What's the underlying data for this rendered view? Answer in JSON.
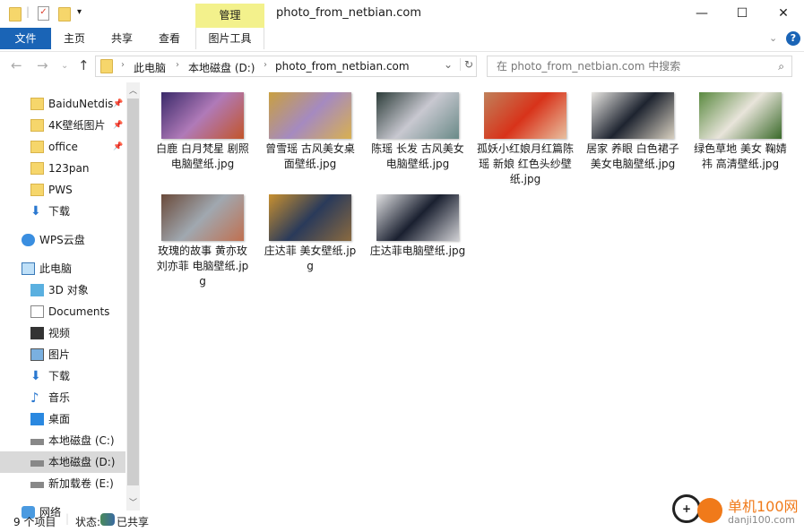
{
  "window": {
    "title": "photo_from_netbian.com",
    "minimize": "—",
    "maximize": "☐",
    "close": "✕"
  },
  "ribbon": {
    "context_group": "管理",
    "tabs": [
      "文件",
      "主页",
      "共享",
      "查看",
      "图片工具"
    ]
  },
  "address": {
    "path": [
      "此电脑",
      "本地磁盘 (D:)",
      "photo_from_netbian.com"
    ],
    "search_placeholder": "在 photo_from_netbian.com 中搜索"
  },
  "sidebar": {
    "items": [
      {
        "label": "BaiduNetdis",
        "icon": "folder-icon",
        "pinned": true
      },
      {
        "label": "4K壁纸图片",
        "icon": "folder-icon",
        "pinned": true
      },
      {
        "label": "office",
        "icon": "folder-icon",
        "pinned": true
      },
      {
        "label": "123pan",
        "icon": "folder-icon"
      },
      {
        "label": "PWS",
        "icon": "folder-icon"
      },
      {
        "label": "下载",
        "icon": "download-icon"
      },
      {
        "label": "WPS云盘",
        "icon": "cloud-icon"
      },
      {
        "label": "此电脑",
        "icon": "computer-icon"
      },
      {
        "label": "3D 对象",
        "icon": "3d-icon"
      },
      {
        "label": "Documents",
        "icon": "document-icon"
      },
      {
        "label": "视频",
        "icon": "video-icon"
      },
      {
        "label": "图片",
        "icon": "picture-icon"
      },
      {
        "label": "下载",
        "icon": "download-icon"
      },
      {
        "label": "音乐",
        "icon": "music-icon"
      },
      {
        "label": "桌面",
        "icon": "desktop-icon"
      },
      {
        "label": "本地磁盘 (C:)",
        "icon": "drive-icon"
      },
      {
        "label": "本地磁盘 (D:)",
        "icon": "drive-icon",
        "selected": true
      },
      {
        "label": "新加载卷 (E:)",
        "icon": "drive-icon"
      },
      {
        "label": "网络",
        "icon": "network-icon"
      }
    ]
  },
  "files": [
    {
      "name": "白鹿 白月梵星 剧照 电脑壁纸.jpg",
      "colors": [
        "#3a2a6a",
        "#b07ab8",
        "#c2552a"
      ]
    },
    {
      "name": "曾雪瑶 古风美女桌面壁纸.jpg",
      "colors": [
        "#c9a040",
        "#a58ac0",
        "#d8b050"
      ]
    },
    {
      "name": "陈瑶 长发 古风美女电脑壁纸.jpg",
      "colors": [
        "#2d3d3a",
        "#c8c8d0",
        "#6a8a88"
      ]
    },
    {
      "name": "孤妖小红娘月红篇陈瑶 新娘 红色头纱壁纸.jpg",
      "colors": [
        "#c0805a",
        "#d8331a",
        "#e8c0a0"
      ]
    },
    {
      "name": "居家 养眼 白色裙子 美女电脑壁纸.jpg",
      "colors": [
        "#e8e6e2",
        "#1e2430",
        "#d8d0c0"
      ]
    },
    {
      "name": "绿色草地 美女 鞠婧祎 高清壁纸.jpg",
      "colors": [
        "#5a8a40",
        "#e8e4da",
        "#3a6a2a"
      ]
    },
    {
      "name": "玫瑰的故事 黄亦玫 刘亦菲 电脑壁纸.jpg",
      "colors": [
        "#6a4a3a",
        "#a0a8b0",
        "#c07050"
      ]
    },
    {
      "name": "庄达菲 美女壁纸.jpg",
      "colors": [
        "#c89030",
        "#2a3a5a",
        "#8a6a40"
      ]
    },
    {
      "name": "庄达菲电脑壁纸.jpg",
      "colors": [
        "#e0e0e2",
        "#1a2030",
        "#d0d0d4"
      ]
    }
  ],
  "status": {
    "count": "9 个项目",
    "state_label": "状态:",
    "state_value": "已共享"
  },
  "watermark": {
    "text": "单机100网",
    "url": "danji100.com"
  }
}
